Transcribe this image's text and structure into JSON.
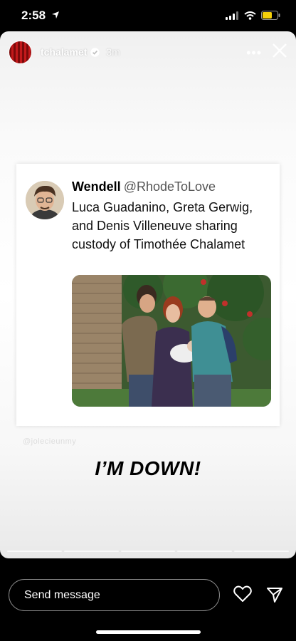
{
  "status_bar": {
    "time": "2:58",
    "icons": [
      "location-arrow-icon",
      "signal-icon",
      "wifi-icon",
      "battery-icon"
    ],
    "battery_color": "#f5d00a"
  },
  "story": {
    "username": "tchalamet",
    "time_ago": "3m",
    "more_label": "•••",
    "progress_segments": 5
  },
  "tweet": {
    "display_name": "Wendell",
    "handle": "@RhodeToLove",
    "text": "Luca Guadanino, Greta Gerwig, and Denis Villeneuve sharing custody of Timothée Chalamet"
  },
  "credit": "@jolecieunmy",
  "caption": "I’M DOWN!",
  "reply": {
    "placeholder": "Send message"
  }
}
